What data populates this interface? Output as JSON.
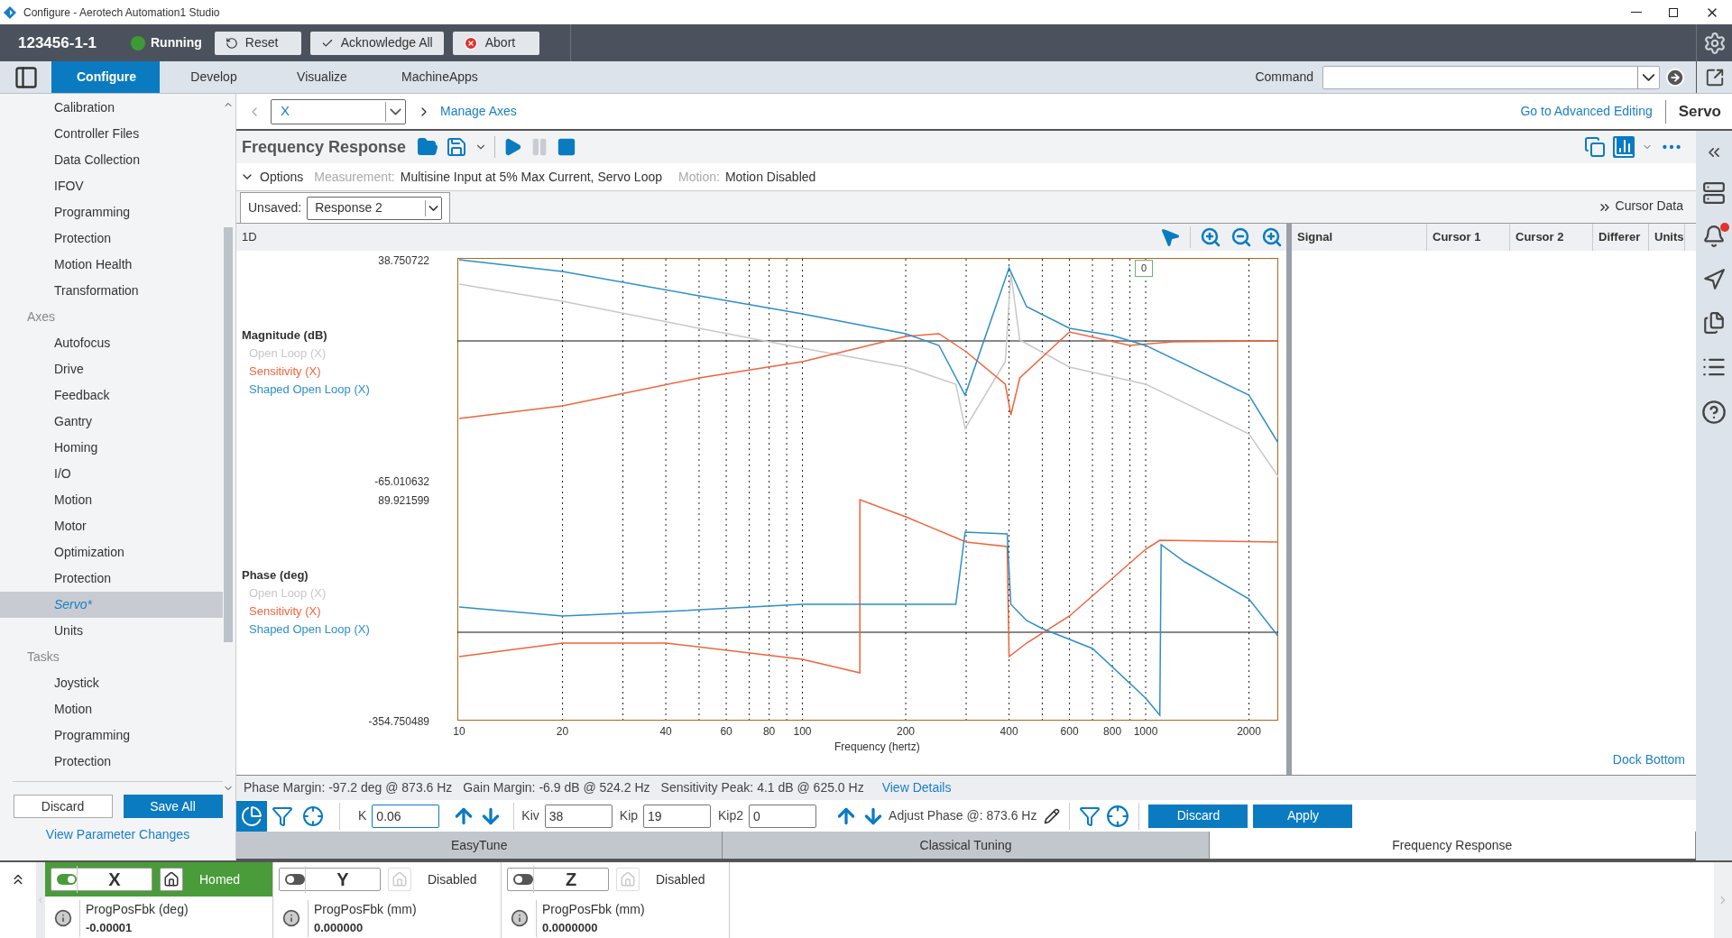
{
  "window": {
    "title": "Configure - Aerotech Automation1 Studio"
  },
  "header": {
    "controller": "123456-1-1",
    "status": "Running",
    "running": true,
    "buttons": [
      {
        "kind": "reset",
        "label": "Reset"
      },
      {
        "kind": "ack",
        "label": "Acknowledge All"
      },
      {
        "kind": "abort",
        "label": "Abort"
      }
    ]
  },
  "main_tabs": [
    {
      "label": "Configure",
      "selected": true
    },
    {
      "label": "Develop",
      "selected": false
    },
    {
      "label": "Visualize",
      "selected": false
    },
    {
      "label": "MachineApps",
      "selected": false
    }
  ],
  "command": {
    "label": "Command"
  },
  "sidebar": {
    "items": [
      {
        "kind": "item",
        "label": "Calibration",
        "selected": false
      },
      {
        "kind": "item",
        "label": "Controller Files",
        "selected": false
      },
      {
        "kind": "item",
        "label": "Data Collection",
        "selected": false
      },
      {
        "kind": "item",
        "label": "IFOV",
        "selected": false
      },
      {
        "kind": "item",
        "label": "Programming",
        "selected": false
      },
      {
        "kind": "item",
        "label": "Protection",
        "selected": false
      },
      {
        "kind": "item",
        "label": "Motion Health",
        "selected": false
      },
      {
        "kind": "item",
        "label": "Transformation",
        "selected": false
      },
      {
        "kind": "header",
        "label": "Axes"
      },
      {
        "kind": "item",
        "label": "Autofocus",
        "selected": false
      },
      {
        "kind": "item",
        "label": "Drive",
        "selected": false
      },
      {
        "kind": "item",
        "label": "Feedback",
        "selected": false
      },
      {
        "kind": "item",
        "label": "Gantry",
        "selected": false
      },
      {
        "kind": "item",
        "label": "Homing",
        "selected": false
      },
      {
        "kind": "item",
        "label": "I/O",
        "selected": false
      },
      {
        "kind": "item",
        "label": "Motion",
        "selected": false
      },
      {
        "kind": "item",
        "label": "Motor",
        "selected": false
      },
      {
        "kind": "item",
        "label": "Optimization",
        "selected": false
      },
      {
        "kind": "item",
        "label": "Protection",
        "selected": false
      },
      {
        "kind": "item",
        "label": "Servo*",
        "selected": true
      },
      {
        "kind": "item",
        "label": "Units",
        "selected": false
      },
      {
        "kind": "header",
        "label": "Tasks"
      },
      {
        "kind": "item",
        "label": "Joystick",
        "selected": false
      },
      {
        "kind": "item",
        "label": "Motion",
        "selected": false
      },
      {
        "kind": "item",
        "label": "Programming",
        "selected": false
      },
      {
        "kind": "item",
        "label": "Protection",
        "selected": false
      }
    ],
    "buttons": [
      "Discard",
      "Save All"
    ],
    "link": "View Parameter Changes"
  },
  "breadcrumb": {
    "axis": "X",
    "link": "Manage Axes",
    "advanced_link": "Go to Advanced Editing",
    "section": "Servo"
  },
  "panel": {
    "title": "Frequency Response",
    "options": "Options",
    "measurement_label": "Measurement:",
    "measurement": "Multisine Input at 5% Max Current, Servo Loop",
    "motion_label": "Motion:",
    "motion": "Motion Disabled",
    "unsaved_label": "Unsaved:",
    "response": "Response 2",
    "cursor_data": "Cursor Data"
  },
  "chart": {
    "mode": "1D",
    "marker": "0",
    "xlabel": "Frequency (hertz)",
    "x_ticks": [
      "10",
      "20",
      "40",
      "60",
      "80",
      "100",
      "200",
      "400",
      "600",
      "800",
      "1000",
      "2000"
    ],
    "magnitude": {
      "title": "Magnitude (dB)",
      "max": "38.750722",
      "min": "-65.010632",
      "legend": [
        {
          "label": "Open Loop (X)",
          "color": "#c8c8cc"
        },
        {
          "label": "Sensitivity (X)",
          "color": "#f0643c"
        },
        {
          "label": "Shaped Open Loop (X)",
          "color": "#2d8fc8"
        }
      ]
    },
    "phase": {
      "title": "Phase (deg)",
      "max": "89.921599",
      "min": "-354.750489",
      "legend": [
        {
          "label": "Open Loop (X)",
          "color": "#c8c8cc"
        },
        {
          "label": "Sensitivity (X)",
          "color": "#f0643c"
        },
        {
          "label": "Shaped Open Loop (X)",
          "color": "#2d8fc8"
        }
      ]
    }
  },
  "cursor_table": {
    "columns": [
      "Signal",
      "Cursor 1",
      "Cursor 2",
      "Differer",
      "Units"
    ],
    "dock_link": "Dock Bottom"
  },
  "metrics": {
    "items": [
      "Phase Margin: -97.2 deg @ 873.6 Hz",
      "Gain Margin: -6.9 dB @ 524.2 Hz",
      "Sensitivity Peak: 4.1 dB @ 625.0 Hz"
    ],
    "link": "View Details"
  },
  "tuning": {
    "modes": [
      {
        "kind": "pie",
        "selected": true
      },
      {
        "kind": "filter",
        "selected": false
      },
      {
        "kind": "target",
        "selected": false
      }
    ],
    "fields": [
      {
        "label": "K",
        "value": "0.06"
      },
      {
        "label": "Kiv",
        "value": "38"
      },
      {
        "label": "Kip",
        "value": "19"
      },
      {
        "label": "Kip2",
        "value": "0"
      }
    ],
    "adjust_phase": "Adjust Phase @: 873.6 Hz",
    "buttons": [
      "Discard",
      "Apply"
    ]
  },
  "tuning_tabs": [
    {
      "label": "EasyTune",
      "selected": false
    },
    {
      "label": "Classical Tuning",
      "selected": false
    },
    {
      "label": "Frequency Response",
      "selected": true
    }
  ],
  "axes": [
    {
      "name": "X",
      "enabled": true,
      "homed": true,
      "status": "Homed",
      "signal": "ProgPosFbk (deg)",
      "value": "-0.00001"
    },
    {
      "name": "Y",
      "enabled": false,
      "homed": false,
      "status": "Disabled",
      "signal": "ProgPosFbk (mm)",
      "value": "0.000000"
    },
    {
      "name": "Z",
      "enabled": false,
      "homed": false,
      "status": "Disabled",
      "signal": "ProgPosFbk (mm)",
      "value": "0.0000000"
    }
  ]
}
